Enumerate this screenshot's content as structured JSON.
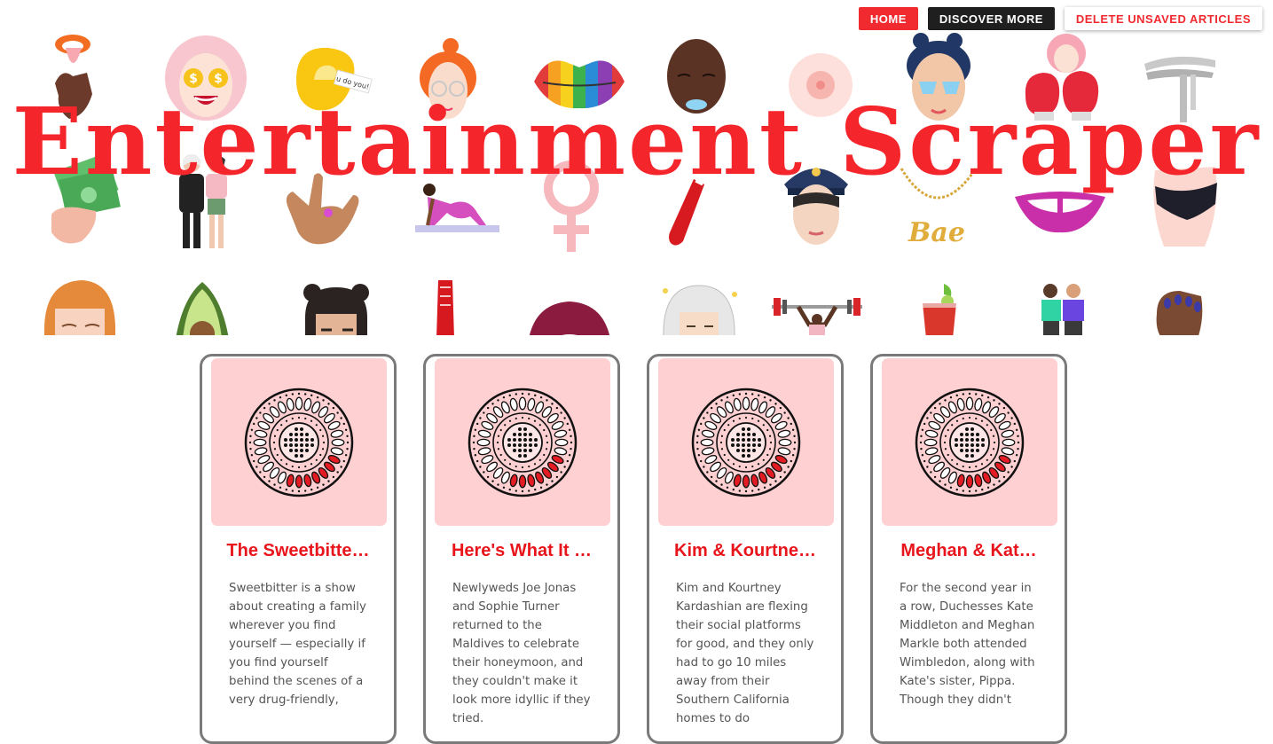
{
  "nav": {
    "home": "HOME",
    "discover": "DISCOVER MORE",
    "delete": "DELETE UNSAVED ARTICLES"
  },
  "hero": {
    "title": "Entertainment Scraper",
    "fortune_text": "u do you!",
    "necklace_text": "Bae"
  },
  "colors": {
    "accent": "#f12a2f",
    "dark": "#1f1f1f",
    "card_image_bg": "#ffd0d1",
    "card_border": "#7a7a7a"
  },
  "articles": [
    {
      "title": "The Sweetbitte…",
      "summary": "Sweetbitter is a show about creating a family wherever you find yourself — especially if you find yourself behind the scenes of a very drug-friendly,",
      "icon": "birth-control-pill-icon"
    },
    {
      "title": "Here's What It …",
      "summary": "Newlyweds Joe Jonas and Sophie Turner returned to the Maldives to celebrate their honeymoon, and they couldn't make it look more idyllic if they tried.",
      "icon": "birth-control-pill-icon"
    },
    {
      "title": "Kim & Kourtne…",
      "summary": "Kim and Kourtney Kardashian are flexing their social platforms for good, and they only had to go 10 miles away from their Southern California homes to do",
      "icon": "birth-control-pill-icon"
    },
    {
      "title": "Meghan & Kat…",
      "summary": "For the second year in a row, Duchesses Kate Middleton and Meghan Markle both attended Wimbledon, along with Kate's sister, Pippa. Though they didn't",
      "icon": "birth-control-pill-icon"
    }
  ]
}
